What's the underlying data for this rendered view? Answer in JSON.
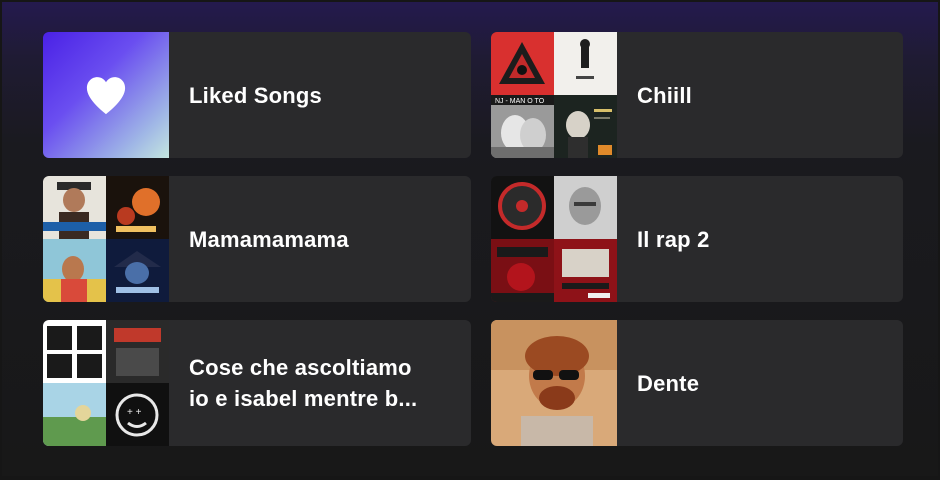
{
  "colors": {
    "background": "#181818",
    "card": "#2a2a2c",
    "text": "#ffffff",
    "liked_gradient_start": "#4a21e6",
    "liked_gradient_end": "#c4e6df"
  },
  "shortcuts": [
    {
      "title": "Liked Songs",
      "icon": "heart-icon"
    },
    {
      "title": "Chiill"
    },
    {
      "title": "Mamamamama"
    },
    {
      "title": "Il rap 2"
    },
    {
      "title": "Cose che ascoltiamo\nio e isabel mentre b..."
    },
    {
      "title": "Dente"
    }
  ]
}
